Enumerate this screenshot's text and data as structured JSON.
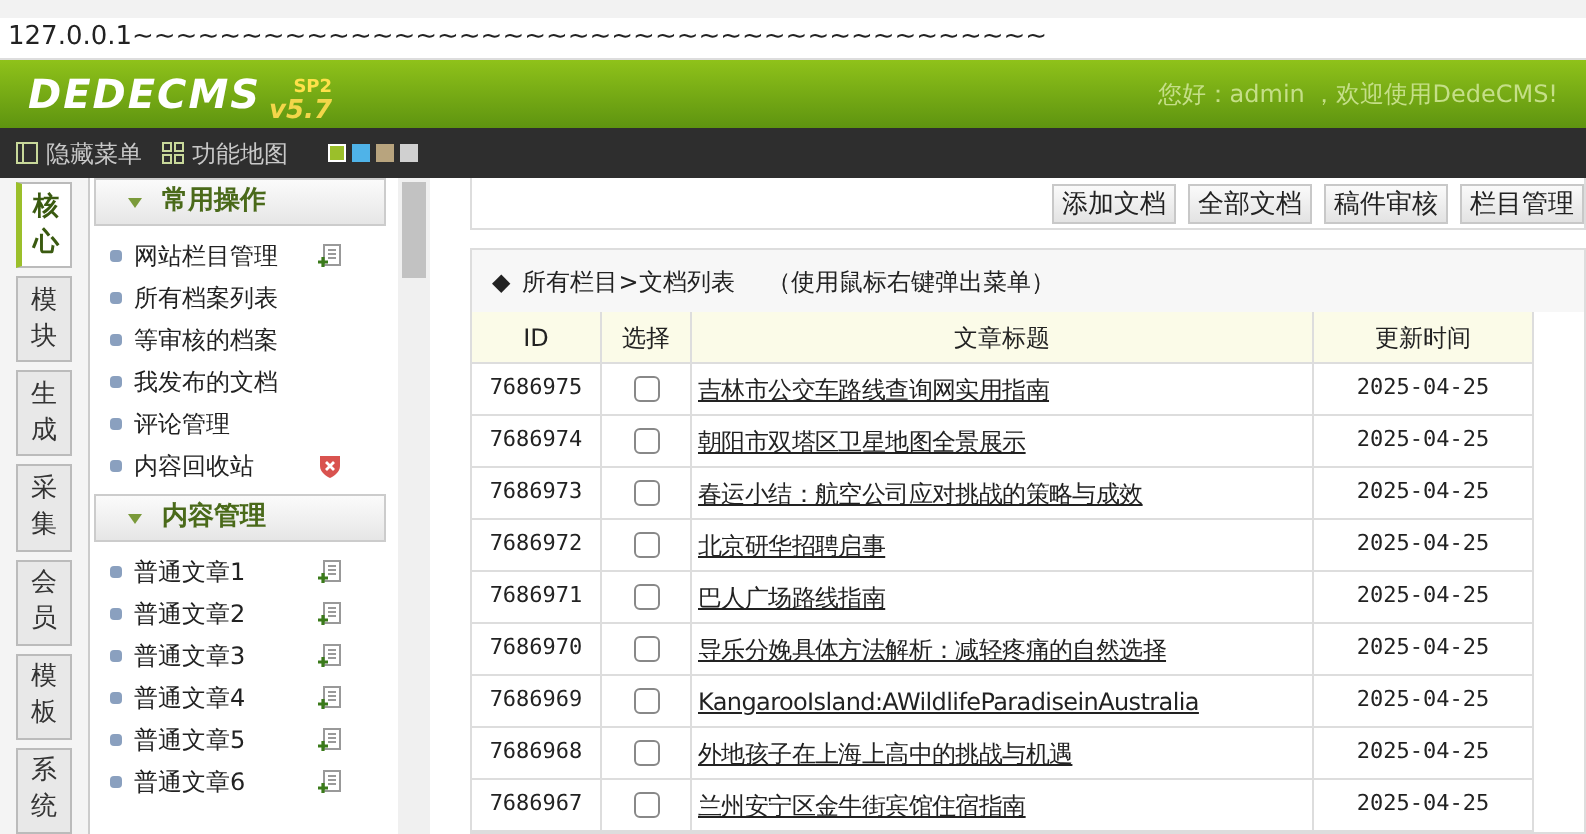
{
  "address_bar": {
    "url": "127.0.0.1~~~~~~~~~~~~~~~~~~~~~~~~~~~~~~~~~~~~~~~~~~"
  },
  "header": {
    "logo": "DEDECMS",
    "version": "v5.7",
    "edition": "SP2",
    "greeting": "您好：admin ，欢迎使用DedeCMS!"
  },
  "toolbar": {
    "items": [
      {
        "kind": "hide",
        "label": "隐藏菜单"
      },
      {
        "kind": "map",
        "label": "功能地图"
      }
    ],
    "themes": [
      {
        "color": "#9bbf2a",
        "selected": true
      },
      {
        "color": "#4fb3e8",
        "selected": false
      },
      {
        "color": "#b8a47e",
        "selected": false
      },
      {
        "color": "#d0d0d0",
        "selected": false
      }
    ]
  },
  "side_tabs": [
    {
      "label": "核心",
      "selected": true
    },
    {
      "label": "模块",
      "selected": false
    },
    {
      "label": "生成",
      "selected": false
    },
    {
      "label": "采集",
      "selected": false
    },
    {
      "label": "会员",
      "selected": false
    },
    {
      "label": "模板",
      "selected": false
    },
    {
      "label": "系统",
      "selected": false
    }
  ],
  "menu_groups": [
    {
      "title": "常用操作",
      "items": [
        {
          "label": "网站栏目管理",
          "kind": "add"
        },
        {
          "label": "所有档案列表",
          "kind": "plain"
        },
        {
          "label": "等审核的档案",
          "kind": "plain"
        },
        {
          "label": "我发布的文档",
          "kind": "plain"
        },
        {
          "label": "评论管理",
          "kind": "plain"
        },
        {
          "label": "内容回收站",
          "kind": "delete"
        }
      ]
    },
    {
      "title": "内容管理",
      "items": [
        {
          "label": "普通文章1",
          "kind": "add"
        },
        {
          "label": "普通文章2",
          "kind": "add"
        },
        {
          "label": "普通文章3",
          "kind": "add"
        },
        {
          "label": "普通文章4",
          "kind": "add"
        },
        {
          "label": "普通文章5",
          "kind": "add"
        },
        {
          "label": "普通文章6",
          "kind": "add"
        }
      ]
    }
  ],
  "actions": [
    "添加文档",
    "全部文档",
    "稿件审核",
    "栏目管理"
  ],
  "list": {
    "marker": "◆",
    "breadcrumb": "所有栏目>文档列表",
    "hint": "（使用鼠标右键弹出菜单）",
    "columns": [
      "ID",
      "选择",
      "文章标题",
      "更新时间"
    ],
    "rows": [
      {
        "id": "7686975",
        "checked": false,
        "title": "吉林市公交车路线查询网实用指南",
        "date": "2025-04-25"
      },
      {
        "id": "7686974",
        "checked": false,
        "title": "朝阳市双塔区卫星地图全景展示",
        "date": "2025-04-25"
      },
      {
        "id": "7686973",
        "checked": false,
        "title": "春运小结：航空公司应对挑战的策略与成效",
        "date": "2025-04-25"
      },
      {
        "id": "7686972",
        "checked": false,
        "title": "北京研华招聘启事",
        "date": "2025-04-25"
      },
      {
        "id": "7686971",
        "checked": false,
        "title": "巴人广场路线指南",
        "date": "2025-04-25"
      },
      {
        "id": "7686970",
        "checked": false,
        "title": "导乐分娩具体方法解析：减轻疼痛的自然选择",
        "date": "2025-04-25"
      },
      {
        "id": "7686969",
        "checked": false,
        "title": "KangarooIsland:AWildlifeParadiseinAustralia",
        "date": "2025-04-25"
      },
      {
        "id": "7686968",
        "checked": false,
        "title": "外地孩子在上海上高中的挑战与机遇",
        "date": "2025-04-25"
      },
      {
        "id": "7686967",
        "checked": false,
        "title": "兰州安宁区金牛街宾馆住宿指南",
        "date": "2025-04-25"
      }
    ]
  }
}
